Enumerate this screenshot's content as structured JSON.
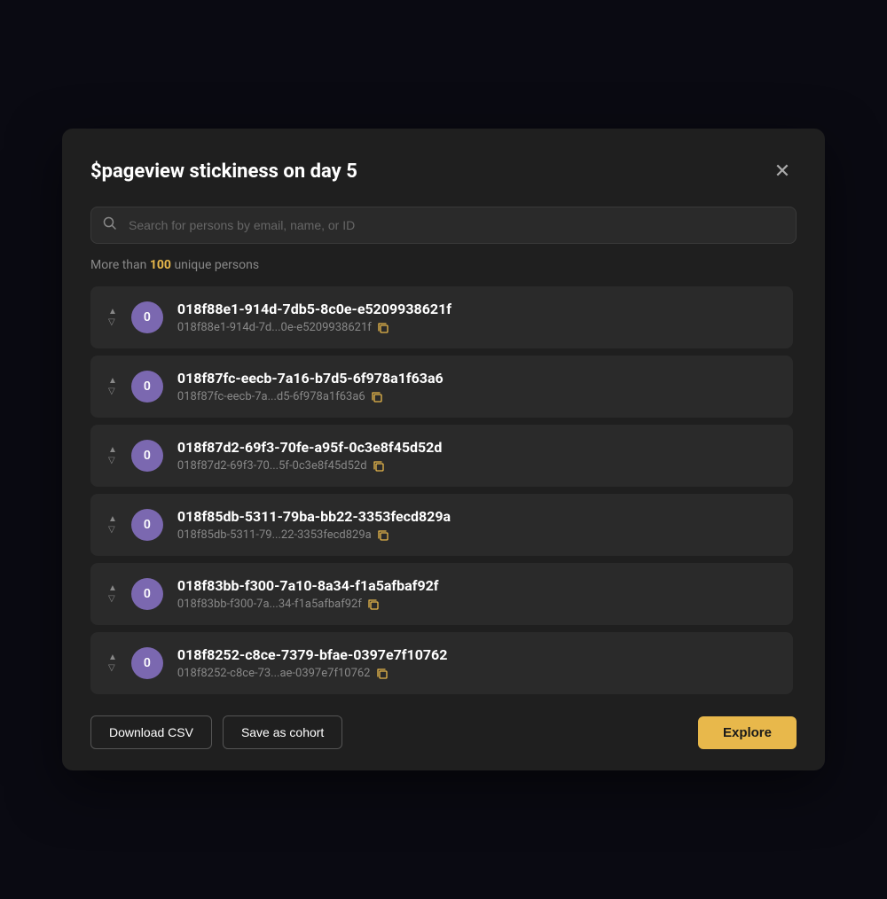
{
  "modal": {
    "title": "$pageview stickiness on day 5",
    "close_label": "×"
  },
  "search": {
    "placeholder": "Search for persons by email, name, or ID"
  },
  "summary": {
    "prefix": "More than",
    "count": "100",
    "suffix": "unique persons"
  },
  "persons": [
    {
      "id": "018f88e1-914d-7db5-8c0e-e5209938621f",
      "short_id": "018f88e1-914d-7d...0e-e5209938621f",
      "avatar_label": "0"
    },
    {
      "id": "018f87fc-eecb-7a16-b7d5-6f978a1f63a6",
      "short_id": "018f87fc-eecb-7a...d5-6f978a1f63a6",
      "avatar_label": "0"
    },
    {
      "id": "018f87d2-69f3-70fe-a95f-0c3e8f45d52d",
      "short_id": "018f87d2-69f3-70...5f-0c3e8f45d52d",
      "avatar_label": "0"
    },
    {
      "id": "018f85db-5311-79ba-bb22-3353fecd829a",
      "short_id": "018f85db-5311-79...22-3353fecd829a",
      "avatar_label": "0"
    },
    {
      "id": "018f83bb-f300-7a10-8a34-f1a5afbaf92f",
      "short_id": "018f83bb-f300-7a...34-f1a5afbaf92f",
      "avatar_label": "0"
    },
    {
      "id": "018f8252-c8ce-7379-bfae-0397e7f10762",
      "short_id": "018f8252-c8ce-73...ae-0397e7f10762",
      "avatar_label": "0"
    }
  ],
  "footer": {
    "download_csv_label": "Download CSV",
    "save_cohort_label": "Save as cohort",
    "explore_label": "Explore"
  },
  "colors": {
    "accent": "#e8b84b",
    "avatar_bg": "#7b68b0"
  }
}
